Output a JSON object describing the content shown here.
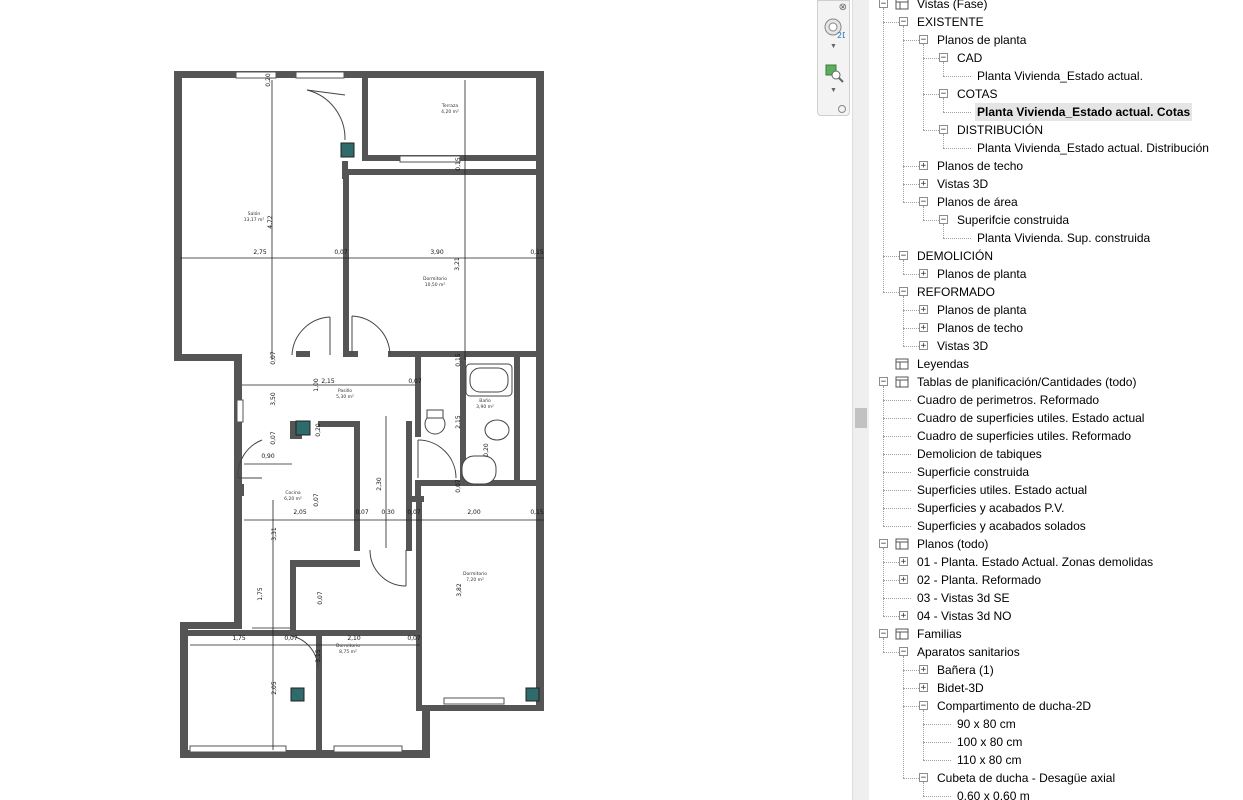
{
  "navbar": {
    "wheel_icon": "steering-wheel-2d-icon",
    "zoom_icon": "zoom-region-icon",
    "wheel_label": "2D"
  },
  "plan": {
    "rooms": [
      {
        "name": "Salón",
        "area": "13,17 m²"
      },
      {
        "name": "Terraza",
        "area": "4,20 m²"
      },
      {
        "name": "Dormitorio",
        "area": "10,50 m²"
      },
      {
        "name": "Pasillo",
        "area": "5,30 m²"
      },
      {
        "name": "Baño",
        "area": "3,90 m²"
      },
      {
        "name": "Cocina",
        "area": "6,20 m²"
      },
      {
        "name": "Dormitorio",
        "area": "7,20 m²"
      },
      {
        "name": "Dormitorio",
        "area": "8,75 m²"
      }
    ],
    "dimensions": [
      "2,75",
      "0,07",
      "3,90",
      "0,15",
      "4,72",
      "3,21",
      "0,20",
      "0,15",
      "0,07",
      "1,00",
      "0,90",
      "2,15",
      "0,07",
      "0,15",
      "2,30",
      "2,15",
      "0,07",
      "3,50",
      "2,05",
      "0,07",
      "0,30",
      "0,07",
      "2,00",
      "0,15",
      "3,31",
      "3,82",
      "1,75",
      "1,75",
      "0,07",
      "2,10",
      "0,07",
      "2,05",
      "3,15",
      "0,20",
      "0,20",
      "0,07",
      "0,07",
      "0,07"
    ]
  },
  "browser": {
    "items": [
      {
        "label": "Vistas (Fase)",
        "level": 0,
        "toggle": "-",
        "icon": "views-icon"
      },
      {
        "label": "EXISTENTE",
        "level": 1,
        "toggle": "-"
      },
      {
        "label": "Planos de planta",
        "level": 2,
        "toggle": "-"
      },
      {
        "label": "CAD",
        "level": 3,
        "toggle": "-"
      },
      {
        "label": "Planta Vivienda_Estado actual.",
        "level": 4,
        "toggle": ""
      },
      {
        "label": "COTAS",
        "level": 3,
        "toggle": "-"
      },
      {
        "label": "Planta Vivienda_Estado actual. Cotas",
        "level": 4,
        "toggle": "",
        "selected": true
      },
      {
        "label": "DISTRIBUCIÓN",
        "level": 3,
        "toggle": "-"
      },
      {
        "label": "Planta Vivienda_Estado actual. Distribución",
        "level": 4,
        "toggle": ""
      },
      {
        "label": "Planos de techo",
        "level": 2,
        "toggle": "+"
      },
      {
        "label": "Vistas 3D",
        "level": 2,
        "toggle": "+"
      },
      {
        "label": "Planos de área",
        "level": 2,
        "toggle": "-"
      },
      {
        "label": "Superifcie construida",
        "level": 3,
        "toggle": "-"
      },
      {
        "label": "Planta Vivienda. Sup. construida",
        "level": 4,
        "toggle": ""
      },
      {
        "label": "DEMOLICIÓN",
        "level": 1,
        "toggle": "-"
      },
      {
        "label": "Planos de planta",
        "level": 2,
        "toggle": "+"
      },
      {
        "label": "REFORMADO",
        "level": 1,
        "toggle": "-"
      },
      {
        "label": "Planos de planta",
        "level": 2,
        "toggle": "+"
      },
      {
        "label": "Planos de techo",
        "level": 2,
        "toggle": "+"
      },
      {
        "label": "Vistas 3D",
        "level": 2,
        "toggle": "+"
      },
      {
        "label": "Leyendas",
        "level": 0,
        "toggle": "",
        "icon": "legends-icon"
      },
      {
        "label": "Tablas de planificación/Cantidades (todo)",
        "level": 0,
        "toggle": "-",
        "icon": "schedules-icon"
      },
      {
        "label": "Cuadro de perimetros. Reformado",
        "level": 1,
        "toggle": ""
      },
      {
        "label": "Cuadro de superficies utiles. Estado actual",
        "level": 1,
        "toggle": ""
      },
      {
        "label": "Cuadro de superficies utiles. Reformado",
        "level": 1,
        "toggle": ""
      },
      {
        "label": "Demolicion de tabiques",
        "level": 1,
        "toggle": ""
      },
      {
        "label": "Superficie construida",
        "level": 1,
        "toggle": ""
      },
      {
        "label": "Superficies utiles. Estado actual",
        "level": 1,
        "toggle": ""
      },
      {
        "label": "Superficies y acabados P.V.",
        "level": 1,
        "toggle": ""
      },
      {
        "label": "Superficies y acabados solados",
        "level": 1,
        "toggle": ""
      },
      {
        "label": "Planos (todo)",
        "level": 0,
        "toggle": "-",
        "icon": "sheets-icon"
      },
      {
        "label": "01 - Planta. Estado Actual.  Zonas demolidas",
        "level": 1,
        "toggle": "+"
      },
      {
        "label": "02 - Planta. Reformado",
        "level": 1,
        "toggle": "+"
      },
      {
        "label": "03 - Vistas 3d SE",
        "level": 1,
        "toggle": ""
      },
      {
        "label": "04 - Vistas 3d NO",
        "level": 1,
        "toggle": "+"
      },
      {
        "label": "Familias",
        "level": 0,
        "toggle": "-",
        "icon": "families-icon"
      },
      {
        "label": "Aparatos sanitarios",
        "level": 1,
        "toggle": "-"
      },
      {
        "label": "Bañera (1)",
        "level": 2,
        "toggle": "+"
      },
      {
        "label": "Bidet-3D",
        "level": 2,
        "toggle": "+"
      },
      {
        "label": "Compartimento de ducha-2D",
        "level": 2,
        "toggle": "-"
      },
      {
        "label": "90 x 80 cm",
        "level": 3,
        "toggle": ""
      },
      {
        "label": "100 x 80 cm",
        "level": 3,
        "toggle": ""
      },
      {
        "label": "110 x 80 cm",
        "level": 3,
        "toggle": ""
      },
      {
        "label": "Cubeta de ducha - Desagüe axial",
        "level": 2,
        "toggle": "-"
      },
      {
        "label": "0,60 x 0,60 m",
        "level": 3,
        "toggle": ""
      }
    ]
  }
}
